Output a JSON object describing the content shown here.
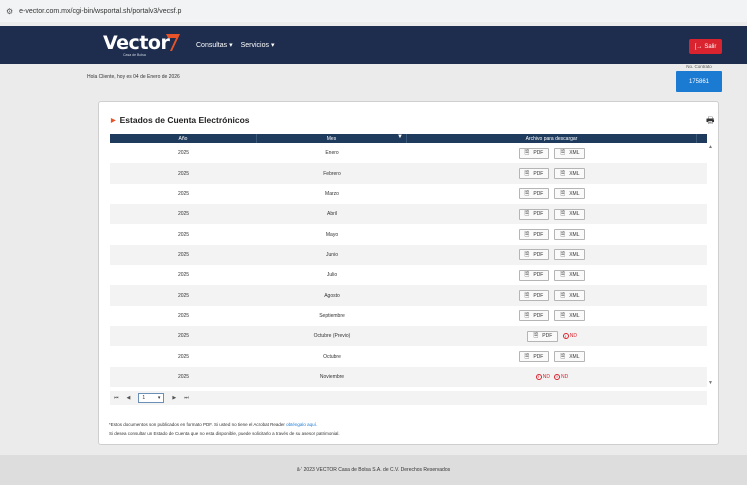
{
  "browser": {
    "url": "e-vector.com.mx/cgi-bin/wsportal.sh/portalv3/vecsf.p"
  },
  "header": {
    "logo_text": "Vector",
    "logo_subtitle": "Casa de Bolsa",
    "menu": [
      {
        "label": "Consultas"
      },
      {
        "label": "Servicios"
      }
    ],
    "logout_label": "Salir",
    "brand_color": "#1e2d4d",
    "accent_color": "#d9232e"
  },
  "info": {
    "greeting": "Hola Cliente, hoy es 04 de Enero de 2026",
    "contract_label": "No. Contrato",
    "contract_number": "175861"
  },
  "panel": {
    "title": "Estados de Cuenta Electrónicos",
    "columns": [
      "Año",
      "Mes",
      "Archivo para descargar"
    ],
    "rows": [
      {
        "year": "2025",
        "month": "Enero",
        "files": [
          "PDF",
          "XML"
        ]
      },
      {
        "year": "2025",
        "month": "Febrero",
        "files": [
          "PDF",
          "XML"
        ]
      },
      {
        "year": "2025",
        "month": "Marzo",
        "files": [
          "PDF",
          "XML"
        ]
      },
      {
        "year": "2025",
        "month": "Abril",
        "files": [
          "PDF",
          "XML"
        ]
      },
      {
        "year": "2025",
        "month": "Mayo",
        "files": [
          "PDF",
          "XML"
        ]
      },
      {
        "year": "2025",
        "month": "Junio",
        "files": [
          "PDF",
          "XML"
        ]
      },
      {
        "year": "2025",
        "month": "Julio",
        "files": [
          "PDF",
          "XML"
        ]
      },
      {
        "year": "2025",
        "month": "Agosto",
        "files": [
          "PDF",
          "XML"
        ]
      },
      {
        "year": "2025",
        "month": "Septiembre",
        "files": [
          "PDF",
          "XML"
        ]
      },
      {
        "year": "2025",
        "month": "Octubre (Previo)",
        "files": [
          "PDF",
          "ND"
        ]
      },
      {
        "year": "2025",
        "month": "Octubre",
        "files": [
          "PDF",
          "XML"
        ]
      },
      {
        "year": "2025",
        "month": "Noviembre",
        "files": [
          "ND",
          "ND"
        ]
      }
    ],
    "pager": {
      "page": "1"
    },
    "note_line1": "*Estos documentos son publicados en formato PDF. Si usted no tiene el Acrobat Reader",
    "note_link": "obténgalo aquí.",
    "note_line2": "Si desea consultar un Estado de Cuenta que no esta disponible, puede solicitarlo a través de su asesor patrimonial."
  },
  "footer": {
    "text": "â·' 2023 VECTOR Casa de Bolsa S.A. de C.V. Derechos Reservados"
  }
}
